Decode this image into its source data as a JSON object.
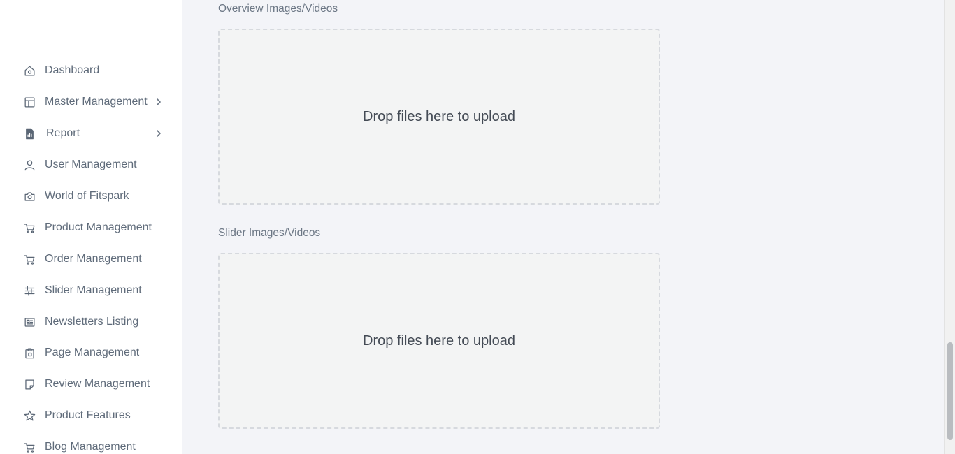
{
  "sidebar": {
    "items": [
      {
        "label": "Dashboard",
        "icon": "home-icon"
      },
      {
        "label": "Master Management",
        "icon": "layout-icon",
        "has_submenu": true
      },
      {
        "label": "Report",
        "icon": "report-file-icon",
        "has_submenu": true
      },
      {
        "label": "User Management",
        "icon": "user-icon"
      },
      {
        "label": "World of Fitspark",
        "icon": "camera-icon"
      },
      {
        "label": "Product Management",
        "icon": "cart-icon"
      },
      {
        "label": "Order Management",
        "icon": "cart-icon"
      },
      {
        "label": "Slider Management",
        "icon": "sliders-icon"
      },
      {
        "label": "Newsletters Listing",
        "icon": "newspaper-icon"
      },
      {
        "label": "Page Management",
        "icon": "clipboard-icon"
      },
      {
        "label": "Review Management",
        "icon": "note-icon"
      },
      {
        "label": "Product Features",
        "icon": "star-icon"
      },
      {
        "label": "Blog Management",
        "icon": "cart-icon"
      }
    ]
  },
  "main": {
    "overview": {
      "label": "Overview Images/Videos",
      "drop_text": "Drop files here to upload"
    },
    "slider": {
      "label": "Slider Images/Videos",
      "drop_text": "Drop files here to upload"
    }
  },
  "colors": {
    "background": "#f3f4f8",
    "sidebar_bg": "#ffffff",
    "text_muted": "#5f6b7a",
    "dropzone_border": "#d6d9de"
  }
}
